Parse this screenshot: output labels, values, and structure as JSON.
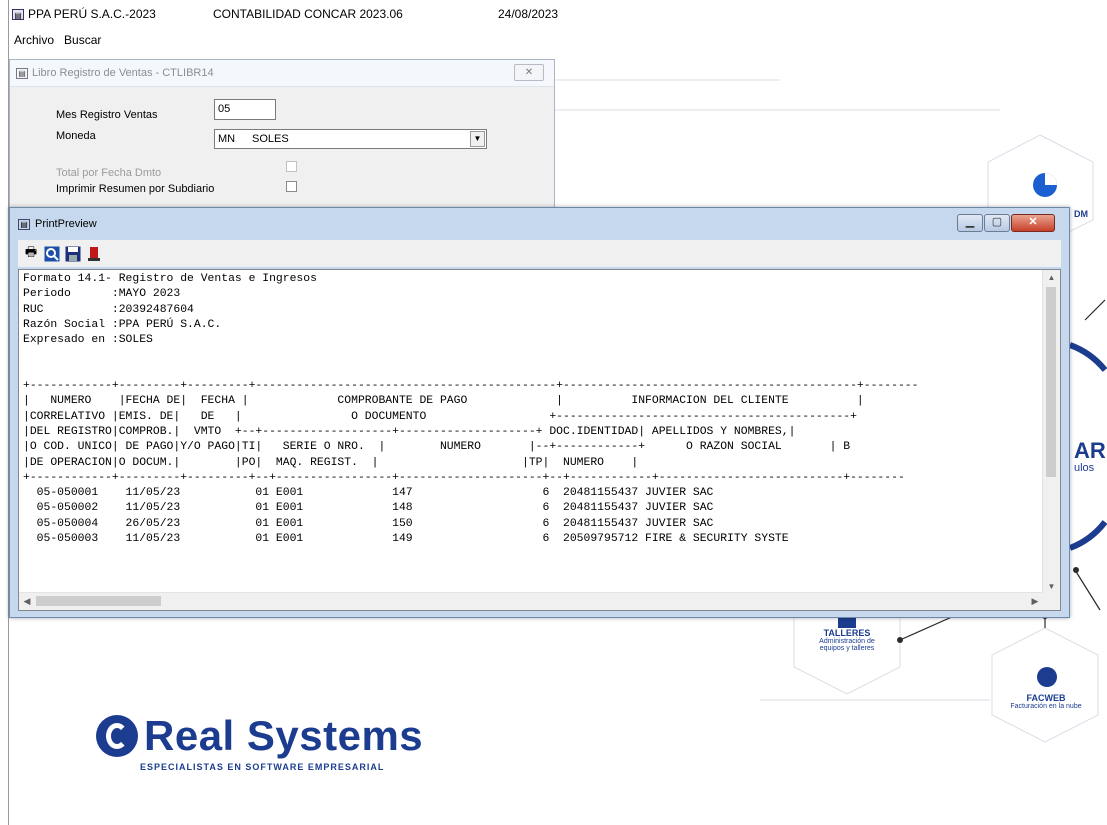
{
  "app": {
    "company": "PPA PERÚ S.A.C.-2023",
    "system": "CONTABILIDAD CONCAR 2023.06",
    "date": "24/08/2023"
  },
  "menu": [
    "Archivo",
    "Buscar"
  ],
  "libro_dialog": {
    "title": "Libro Registro de Ventas - CTLIBR14",
    "mes_label": "Mes Registro Ventas",
    "mes_value": "05",
    "moneda_label": "Moneda",
    "moneda_code": "MN",
    "moneda_name": "SOLES",
    "total_label": "Total por Fecha Dmto",
    "resumen_label": "Imprimir Resumen por Subdiario"
  },
  "preview": {
    "title": "PrintPreview",
    "toolbar": [
      "print-icon",
      "zoom-icon",
      "save-icon",
      "exit-icon"
    ],
    "report_lines": [
      "Formato 14.1- Registro de Ventas e Ingresos",
      "Periodo      :MAYO 2023",
      "RUC          :20392487604",
      "Razón Social :PPA PERÚ S.A.C.",
      "Expresado en :SOLES",
      "",
      "",
      "+------------+---------+---------+--------------------------------------------+-------------------------------------------+--------",
      "|   NUMERO    |FECHA DE|  FECHA |             COMPROBANTE DE PAGO             |          INFORMACION DEL CLIENTE          |",
      "|CORRELATIVO |EMIS. DE|   DE   |                O DOCUMENTO                  +-------------------------------------------+",
      "|DEL REGISTRO|COMPROB.|  VMTO  +--+-------------------+--------------------+ DOC.IDENTIDAD| APELLIDOS Y NOMBRES,|",
      "|O COD. UNICO| DE PAGO|Y/O PAGO|TI|   SERIE O NRO.  |        NUMERO       |--+------------+      O RAZON SOCIAL       | B",
      "|DE OPERACION|O DOCUM.|        |PO|  MAQ. REGIST.  |                     |TP|  NUMERO    |",
      "+------------+---------+---------+--+-----------------+---------------------+--+------------+---------------------------+--------",
      "  05-050001    11/05/23           01 E001             147                   6  20481155437 JUVIER SAC",
      "  05-050002    11/05/23           01 E001             148                   6  20481155437 JUVIER SAC",
      "  05-050004    26/05/23           01 E001             150                   6  20481155437 JUVIER SAC",
      "  05-050003    11/05/23           01 E001             149                   6  20509795712 FIRE & SECURITY SYSTE"
    ]
  },
  "branding": {
    "company": "Real Systems",
    "tagline": "ESPECIALISTAS EN SOFTWARE EMPRESARIAL",
    "talleres_name": "TALLERES",
    "talleres_desc": "Administración de equipos y talleres",
    "facweb_name": "FACWEB",
    "facweb_desc": "Facturación en la nube",
    "partial_1": "DM",
    "partial_2": "AR",
    "partial_3": "ulos"
  }
}
